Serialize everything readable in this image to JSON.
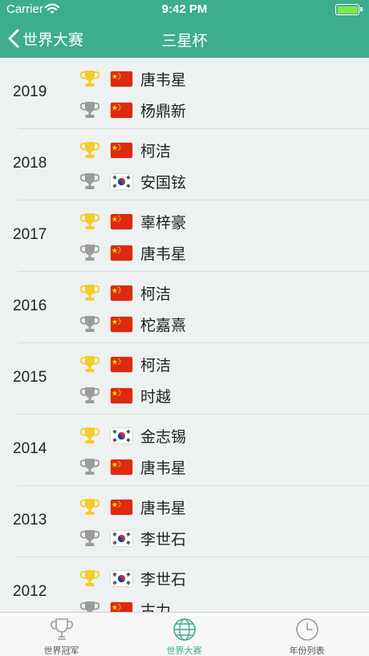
{
  "status_bar": {
    "carrier": "Carrier",
    "time": "9:42 PM"
  },
  "nav": {
    "back_label": "世界大赛",
    "title": "三星杯"
  },
  "colors": {
    "accent": "#3dae8d",
    "gold": "#f4cd2a",
    "silver": "#9b9b9b"
  },
  "seasons": [
    {
      "year": "2019",
      "winner": {
        "name": "唐韦星",
        "flag": "cn"
      },
      "runner_up": {
        "name": "杨鼎新",
        "flag": "cn"
      }
    },
    {
      "year": "2018",
      "winner": {
        "name": "柯洁",
        "flag": "cn"
      },
      "runner_up": {
        "name": "安国铉",
        "flag": "kr"
      }
    },
    {
      "year": "2017",
      "winner": {
        "name": "辜梓豪",
        "flag": "cn"
      },
      "runner_up": {
        "name": "唐韦星",
        "flag": "cn"
      }
    },
    {
      "year": "2016",
      "winner": {
        "name": "柯洁",
        "flag": "cn"
      },
      "runner_up": {
        "name": "柁嘉熹",
        "flag": "cn"
      }
    },
    {
      "year": "2015",
      "winner": {
        "name": "柯洁",
        "flag": "cn"
      },
      "runner_up": {
        "name": "时越",
        "flag": "cn"
      }
    },
    {
      "year": "2014",
      "winner": {
        "name": "金志锡",
        "flag": "kr"
      },
      "runner_up": {
        "name": "唐韦星",
        "flag": "cn"
      }
    },
    {
      "year": "2013",
      "winner": {
        "name": "唐韦星",
        "flag": "cn"
      },
      "runner_up": {
        "name": "李世石",
        "flag": "kr"
      }
    },
    {
      "year": "2012",
      "winner": {
        "name": "李世石",
        "flag": "kr"
      },
      "runner_up": {
        "name": "古力",
        "flag": "cn"
      }
    }
  ],
  "tabs": [
    {
      "label": "世界冠军",
      "icon": "trophy-outline-icon",
      "active": false
    },
    {
      "label": "世界大赛",
      "icon": "globe-icon",
      "active": true
    },
    {
      "label": "年份列表",
      "icon": "clock-icon",
      "active": false
    }
  ]
}
